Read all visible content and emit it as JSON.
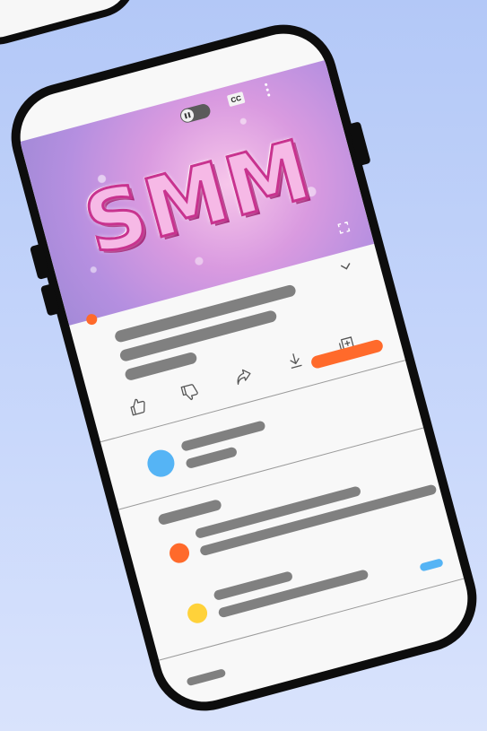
{
  "video": {
    "logo_text": "SMM",
    "cc_label": "CC"
  },
  "colors": {
    "progress": "#ff6a2b",
    "subscribe": "#ff6a2b",
    "channel_avatar": "#55b4f5",
    "comment_avatar_1": "#ff6a2b",
    "comment_avatar_2": "#ffd23a",
    "link_accent": "#55b4f5",
    "placeholder": "#808080",
    "icon": "#555555"
  },
  "icons": {
    "pause": "pause-icon",
    "captions": "cc-icon",
    "more": "more-vertical-icon",
    "fullscreen": "fullscreen-icon",
    "expand": "chevron-down-icon",
    "like": "thumbs-up-icon",
    "dislike": "thumbs-down-icon",
    "share": "share-icon",
    "download": "download-icon",
    "save": "add-to-playlist-icon"
  }
}
